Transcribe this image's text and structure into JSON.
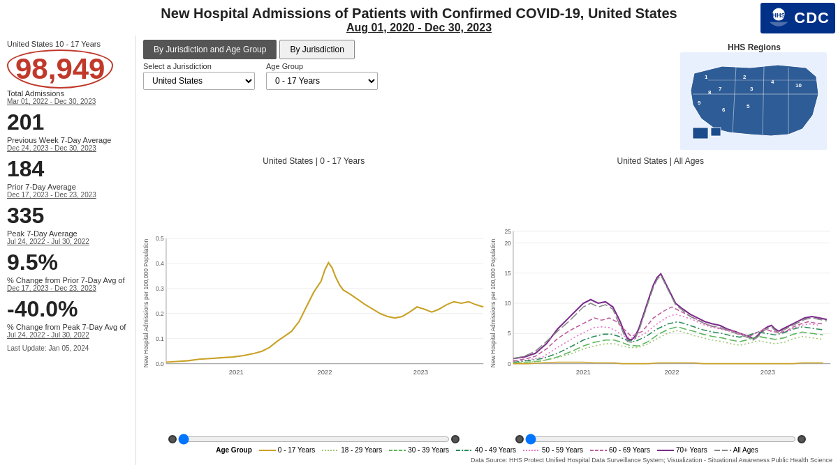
{
  "header": {
    "title": "New Hospital Admissions of Patients with Confirmed COVID-19, United States",
    "date_range": "Aug 01, 2020 - Dec 30, 2023",
    "cdc_label": "CDC"
  },
  "left_panel": {
    "subtitle": "United States 10 - 17 Years",
    "total_admissions": "98,949",
    "total_admissions_label": "Total Admissions",
    "total_admissions_date": "Mar 01, 2022 - Dec 30, 2023",
    "prev_week_avg": "201",
    "prev_week_label": "Previous Week 7-Day Average",
    "prev_week_date": "Dec 24, 2023 - Dec 30, 2023",
    "prior_avg": "184",
    "prior_avg_label": "Prior 7-Day Average",
    "prior_avg_date": "Dec 17, 2023 - Dec 23, 2023",
    "peak_avg": "335",
    "peak_avg_label": "Peak 7-Day Average",
    "peak_avg_date": "Jul 24, 2022 - Jul 30, 2022",
    "pct_change_prior": "9.5%",
    "pct_change_prior_label": "% Change from Prior 7-Day Avg of",
    "pct_change_prior_date": "Dec 17, 2023 - Dec 23, 2023",
    "pct_change_peak": "-40.0%",
    "pct_change_peak_label": "% Change from Peak 7-Day Avg of",
    "pct_change_peak_date": "Jul 24, 2022 - Jul 30, 2022",
    "last_update": "Last Update: Jan 05, 2024"
  },
  "tabs": {
    "tab1": "By Jurisdiction and Age Group",
    "tab2": "By Jurisdiction"
  },
  "selects": {
    "jurisdiction_label": "Select a Jurisdiction",
    "jurisdiction_value": "United States",
    "age_group_label": "Age Group",
    "age_group_value": "0 - 17 Years"
  },
  "chart_left": {
    "title": "United States | 0 - 17 Years",
    "y_label": "New Hospital Admissions per 100,000 Population",
    "y_ticks": [
      "0.0",
      "0.1",
      "0.2",
      "0.3",
      "0.4",
      "0.5"
    ],
    "x_ticks": [
      "2021",
      "2022",
      "2023"
    ]
  },
  "chart_right": {
    "title": "United States | All Ages",
    "y_label": "New Hospital Admissions per 100,000 Population",
    "y_ticks": [
      "0",
      "5",
      "10",
      "15",
      "20",
      "25"
    ],
    "x_ticks": [
      "2021",
      "2022",
      "2023"
    ]
  },
  "map": {
    "title": "HHS Regions"
  },
  "legend": {
    "items": [
      {
        "label": "0 - 17 Years",
        "color": "#c9a227",
        "style": "solid"
      },
      {
        "label": "18 - 29 Years",
        "color": "#a0c878",
        "style": "dotted"
      },
      {
        "label": "30 - 39 Years",
        "color": "#5cb85c",
        "style": "dashed"
      },
      {
        "label": "40 - 49 Years",
        "color": "#2c8c5a",
        "style": "longdash"
      },
      {
        "label": "50 - 59 Years",
        "color": "#e878c8",
        "style": "dotted"
      },
      {
        "label": "60 - 69 Years",
        "color": "#c060a0",
        "style": "dashed"
      },
      {
        "label": "70+ Years",
        "color": "#7b2d8b",
        "style": "solid"
      },
      {
        "label": "All Ages",
        "color": "#888888",
        "style": "longdash"
      }
    ],
    "prefix": "Age Group"
  },
  "footer": {
    "note": "Data Source: HHS Protect Unified Hospital Data Surveillance System; Visualization - Situational Awareness Public Health Science"
  }
}
